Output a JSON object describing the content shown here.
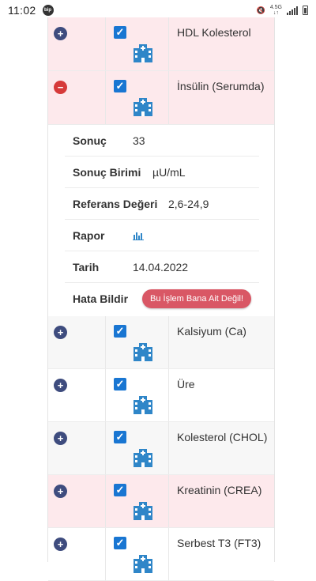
{
  "status_bar": {
    "time": "11:02",
    "carrier_badge": "bip",
    "network": "4.5G",
    "network_sub": "↓↑"
  },
  "rows_top": [
    {
      "toggle": "+",
      "name": "HDL Kolesterol",
      "checked": true
    },
    {
      "toggle": "−",
      "name": "İnsülin (Serumda)",
      "checked": true
    }
  ],
  "detail": {
    "result_label": "Sonuç",
    "result_value": "33",
    "unit_label": "Sonuç Birimi",
    "unit_value": "µU/mL",
    "ref_label": "Referans Değeri",
    "ref_value": "2,6-24,9",
    "report_label": "Rapor",
    "date_label": "Tarih",
    "date_value": "14.04.2022",
    "error_label": "Hata Bildir",
    "error_button": "Bu İşlem Bana Ait Değil!"
  },
  "rows_bottom": [
    {
      "toggle": "+",
      "name": "Kalsiyum (Ca)",
      "checked": true
    },
    {
      "toggle": "+",
      "name": "Üre",
      "checked": true
    },
    {
      "toggle": "+",
      "name": "Kolesterol (CHOL)",
      "checked": true
    },
    {
      "toggle": "+",
      "name": "Kreatinin (CREA)",
      "checked": true
    },
    {
      "toggle": "+",
      "name": "Serbest T3 (FT3)",
      "checked": true
    }
  ],
  "colors": {
    "toggle_plus": "#3e4c7e",
    "toggle_minus": "#d63a3a",
    "checkbox": "#1976d2",
    "hospital_icon": "#2f86c8",
    "error_button": "#d95765",
    "pink_row": "#fde9ec"
  },
  "icons": {
    "toggle_plus": "plus-circle-icon",
    "toggle_minus": "minus-circle-icon",
    "checkbox": "checkbox-checked-icon",
    "hospital": "hospital-icon",
    "report": "bar-chart-icon"
  }
}
